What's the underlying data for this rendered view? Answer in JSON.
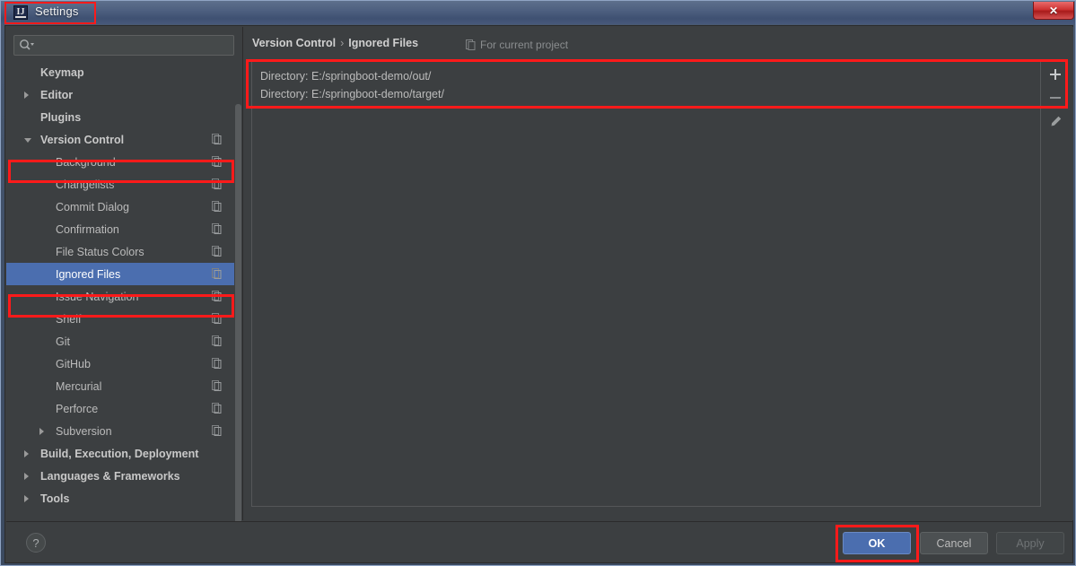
{
  "window": {
    "title": "Settings",
    "app_icon": "intellij-idea-icon",
    "close_label": "✕"
  },
  "search": {
    "placeholder": "",
    "value": "",
    "icon": "search-icon"
  },
  "sidebar": {
    "items": [
      {
        "label": "Keymap",
        "indent": 38,
        "bold": true,
        "arrow": "none",
        "copy": false,
        "selected": false
      },
      {
        "label": "Editor",
        "indent": 38,
        "bold": true,
        "arrow": "right",
        "copy": false,
        "selected": false
      },
      {
        "label": "Plugins",
        "indent": 38,
        "bold": true,
        "arrow": "none",
        "copy": false,
        "selected": false
      },
      {
        "label": "Version Control",
        "indent": 38,
        "bold": true,
        "arrow": "down",
        "copy": true,
        "selected": false
      },
      {
        "label": "Background",
        "indent": 55,
        "bold": false,
        "arrow": "none",
        "copy": true,
        "selected": false
      },
      {
        "label": "Changelists",
        "indent": 55,
        "bold": false,
        "arrow": "none",
        "copy": true,
        "selected": false
      },
      {
        "label": "Commit Dialog",
        "indent": 55,
        "bold": false,
        "arrow": "none",
        "copy": true,
        "selected": false
      },
      {
        "label": "Confirmation",
        "indent": 55,
        "bold": false,
        "arrow": "none",
        "copy": true,
        "selected": false
      },
      {
        "label": "File Status Colors",
        "indent": 55,
        "bold": false,
        "arrow": "none",
        "copy": true,
        "selected": false
      },
      {
        "label": "Ignored Files",
        "indent": 55,
        "bold": false,
        "arrow": "none",
        "copy": true,
        "selected": true
      },
      {
        "label": "Issue Navigation",
        "indent": 55,
        "bold": false,
        "arrow": "none",
        "copy": true,
        "selected": false
      },
      {
        "label": "Shelf",
        "indent": 55,
        "bold": false,
        "arrow": "none",
        "copy": true,
        "selected": false
      },
      {
        "label": "Git",
        "indent": 55,
        "bold": false,
        "arrow": "none",
        "copy": true,
        "selected": false
      },
      {
        "label": "GitHub",
        "indent": 55,
        "bold": false,
        "arrow": "none",
        "copy": true,
        "selected": false
      },
      {
        "label": "Mercurial",
        "indent": 55,
        "bold": false,
        "arrow": "none",
        "copy": true,
        "selected": false
      },
      {
        "label": "Perforce",
        "indent": 55,
        "bold": false,
        "arrow": "none",
        "copy": true,
        "selected": false
      },
      {
        "label": "Subversion",
        "indent": 55,
        "bold": false,
        "arrow": "right",
        "copy": true,
        "selected": false
      },
      {
        "label": "Build, Execution, Deployment",
        "indent": 38,
        "bold": true,
        "arrow": "right",
        "copy": false,
        "selected": false
      },
      {
        "label": "Languages & Frameworks",
        "indent": 38,
        "bold": true,
        "arrow": "right",
        "copy": false,
        "selected": false
      },
      {
        "label": "Tools",
        "indent": 38,
        "bold": true,
        "arrow": "right",
        "copy": false,
        "selected": false
      }
    ]
  },
  "main": {
    "breadcrumb_parent": "Version Control",
    "breadcrumb_separator": "›",
    "breadcrumb_current": "Ignored Files",
    "scope_note": "For current project",
    "scope_icon": "project-scope-icon",
    "ignored_entries": [
      "Directory: E:/springboot-demo/out/",
      "Directory: E:/springboot-demo/target/"
    ],
    "toolbar": {
      "add_tooltip": "Add",
      "remove_tooltip": "Remove",
      "edit_tooltip": "Edit"
    }
  },
  "footer": {
    "help_label": "?",
    "ok_label": "OK",
    "cancel_label": "Cancel",
    "apply_label": "Apply"
  },
  "colors": {
    "accent": "#4b6eaf",
    "panel_bg": "#3c3f41",
    "highlight_red": "#ff1a1a",
    "text": "#bbbbbb"
  }
}
